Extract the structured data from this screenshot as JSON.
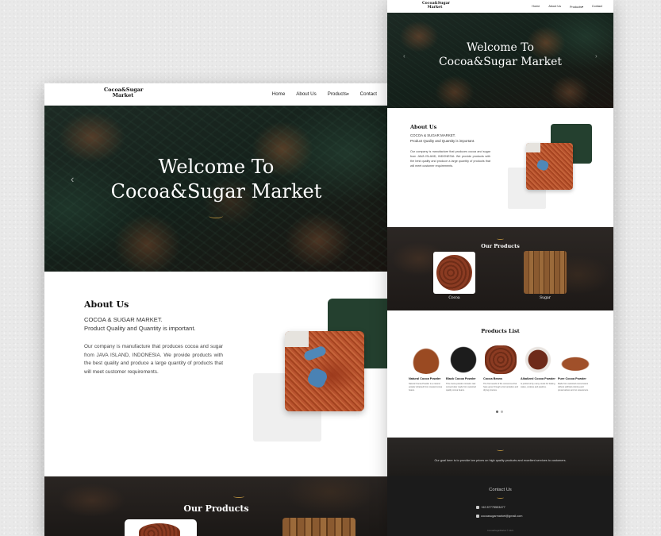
{
  "brand": {
    "line1": "Cocoa&Sugar",
    "line2": "Market"
  },
  "nav": {
    "home": "Home",
    "about": "About Us",
    "products": "Products",
    "contact": "Contact",
    "caret": "▾"
  },
  "hero": {
    "line1": "Welcome To",
    "line2": "Cocoa&Sugar Market",
    "prev": "‹",
    "next": "›"
  },
  "about": {
    "title": "About Us",
    "sub1": "COCOA & SUGAR MARKET.",
    "sub2": "Product Quality and Quantity is important.",
    "body": "Our company is manufacture that produces cocoa and sugar from JAVA ISLAND, INDONESIA. We provide products with the best quality and produce a large quantity of products that will meet customer requirements."
  },
  "our_products": {
    "title": "Our Products",
    "cocoa": "Cocoa",
    "sugar": "Sugar"
  },
  "products_list": {
    "title": "Products List",
    "items": [
      {
        "name": "Natural Cocoa Powder",
        "desc": "Natural Cocoa Powder is a natural powder obtained from roasted cocoa beans."
      },
      {
        "name": "Black Cocoa Powder",
        "desc": "This cocoa powder contains real cocoa butter made from selected quality cocoa beans."
      },
      {
        "name": "Cocoa Beans",
        "desc": "The fruit seeds of the cocoa tree that have gone through a fermentation and drying process."
      },
      {
        "name": "Alkalized Cocoa Powder",
        "desc": "Is preferred by many cooks for baking cakes, cookies and pastries."
      },
      {
        "name": "Pure Cocoa Powder",
        "desc": "Made from selected cocoa beans without artificial coloring and preservatives and no sweeteners."
      }
    ]
  },
  "goal": {
    "text": "Our goal here is to provide low prices on high quality products and excellent services to customers."
  },
  "contact": {
    "title": "Contact Us",
    "phone": "+62 87775553477",
    "email": "cocoasugarmarket@gmail.com",
    "copyright": "Cocoa&SugarMarket © 2021"
  },
  "colors": {
    "accent_green": "#24402f",
    "gold": "#b08a3c"
  }
}
